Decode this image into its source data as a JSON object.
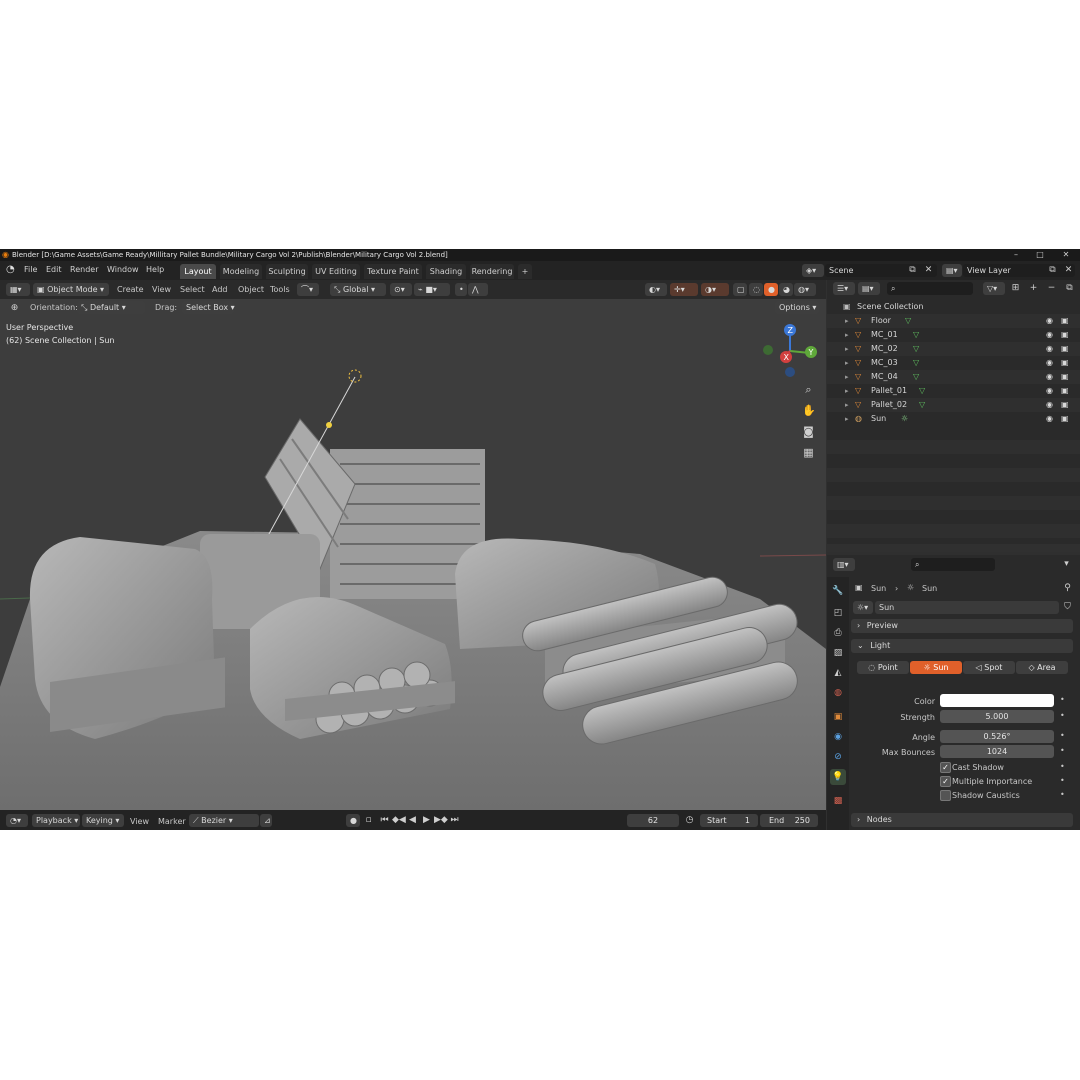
{
  "window": {
    "title": "Blender [D:\\Game Assets\\Game Ready\\Millitary Pallet Bundle\\Military Cargo Vol 2\\Publish\\Blender\\Military Cargo Vol 2.blend]",
    "minimize": "–",
    "maximize": "□",
    "close": "✕"
  },
  "menu": [
    "File",
    "Edit",
    "Render",
    "Window",
    "Help"
  ],
  "workspaces": [
    "Layout",
    "Modeling",
    "Sculpting",
    "UV Editing",
    "Texture Paint",
    "Shading",
    "Rendering"
  ],
  "add_workspace": "+",
  "scene": {
    "name": "Scene",
    "view_layer": "View Layer"
  },
  "toolbar": {
    "mode": "Object Mode",
    "menus": [
      "Create",
      "View",
      "Select",
      "Add",
      "Object",
      "Tools"
    ],
    "transform": "Global",
    "orientation_label": "Orientation:",
    "orientation_value": "Default",
    "drag_label": "Drag:",
    "drag_value": "Select Box",
    "options": "Options"
  },
  "viewport": {
    "overlay_line1": "User Perspective",
    "overlay_line2": "(62) Scene Collection | Sun",
    "gizmo": {
      "z": "Z",
      "y": "Y",
      "x": "X"
    }
  },
  "outliner": {
    "collection": "Scene Collection",
    "items": [
      {
        "name": "Floor"
      },
      {
        "name": "MC_01"
      },
      {
        "name": "MC_02"
      },
      {
        "name": "MC_03"
      },
      {
        "name": "MC_04"
      },
      {
        "name": "Pallet_01"
      },
      {
        "name": "Pallet_02"
      },
      {
        "name": "Sun"
      }
    ]
  },
  "properties": {
    "breadcrumb_object": "Sun",
    "breadcrumb_data": "Sun",
    "datablock": "Sun",
    "panel_preview": "Preview",
    "panel_light": "Light",
    "light_types": [
      "Point",
      "Sun",
      "Spot",
      "Area"
    ],
    "active_light_type": "Sun",
    "color_label": "Color",
    "strength_label": "Strength",
    "strength_value": "5.000",
    "angle_label": "Angle",
    "angle_value": "0.526°",
    "bounces_label": "Max Bounces",
    "bounces_value": "1024",
    "cast_shadow": "Cast Shadow",
    "multiple_importance": "Multiple Importance",
    "shadow_caustics": "Shadow Caustics",
    "panel_nodes": "Nodes"
  },
  "timeline": {
    "playback": "Playback",
    "keying": "Keying",
    "view": "View",
    "marker": "Marker",
    "interp": "Bezier",
    "current_frame": "62",
    "start_label": "Start",
    "start_value": "1",
    "end_label": "End",
    "end_value": "250"
  },
  "colors": {
    "accent_orange": "#e0602a",
    "active_tab": "#4a4a4a",
    "outliner_icon": "#e08a3a",
    "mesh_icon": "#5fbf5f",
    "gizmo_x": "#d2403f",
    "gizmo_y": "#5fa83a",
    "gizmo_z": "#3b78d8"
  }
}
